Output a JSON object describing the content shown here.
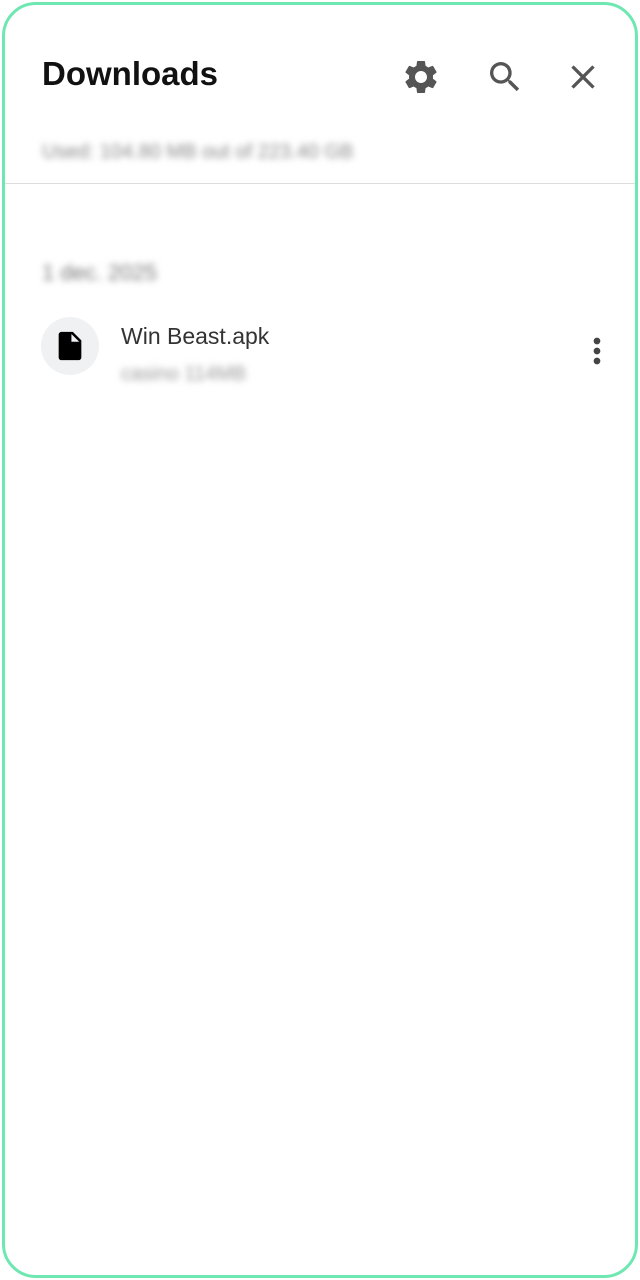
{
  "header": {
    "title": "Downloads",
    "storage_text": "Used: 104.80 MB out of 223.40 GB"
  },
  "icons": {
    "settings": "gear-icon",
    "search": "search-icon",
    "close": "close-icon",
    "file": "file-icon",
    "more": "more-vert-icon"
  },
  "sections": [
    {
      "date": "1 dec. 2025",
      "items": [
        {
          "name": "Win Beast.apk",
          "meta": "casino 114MB"
        }
      ]
    }
  ],
  "colors": {
    "frame_border": "#6ee7b1",
    "icon": "#555555",
    "title": "#111111"
  }
}
